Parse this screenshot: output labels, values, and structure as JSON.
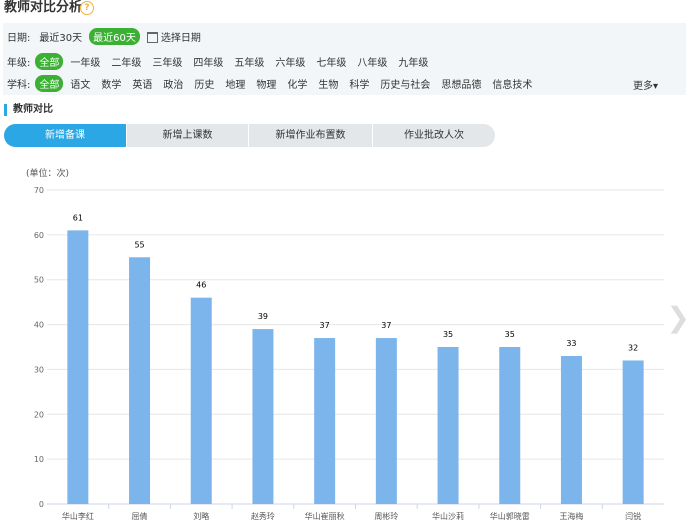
{
  "page": {
    "title": "教师对比分析",
    "help_icon": "question-circle-icon"
  },
  "filters": {
    "date": {
      "label": "日期:",
      "options": [
        "最近30天",
        "最近60天"
      ],
      "active_index": 1,
      "picker_label": "选择日期",
      "picker_icon": "calendar-icon"
    },
    "grade": {
      "label": "年级:",
      "options": [
        "全部",
        "一年级",
        "二年级",
        "三年级",
        "四年级",
        "五年级",
        "六年级",
        "七年级",
        "八年级",
        "九年级"
      ],
      "active_index": 0
    },
    "subject": {
      "label": "学科:",
      "options": [
        "全部",
        "语文",
        "数学",
        "英语",
        "政治",
        "历史",
        "地理",
        "物理",
        "化学",
        "生物",
        "科学",
        "历史与社会",
        "思想品德",
        "信息技术"
      ],
      "active_index": 0,
      "more_label": "更多"
    }
  },
  "section": {
    "title": "教师对比"
  },
  "tabs": [
    {
      "label": "新增备课",
      "active": true
    },
    {
      "label": "新增上课数",
      "active": false
    },
    {
      "label": "新增作业布置数",
      "active": false
    },
    {
      "label": "作业批改人次",
      "active": false
    }
  ],
  "chart_data": {
    "type": "bar",
    "unit_label": "(单位：次)",
    "categories": [
      "华山李红",
      "屈倩",
      "刘略",
      "赵秀玲",
      "华山崔丽秋",
      "周彬玲",
      "华山沙莉",
      "华山郭晓雷",
      "王海梅",
      "闫锐"
    ],
    "values": [
      61,
      55,
      46,
      39,
      37,
      37,
      35,
      35,
      33,
      32
    ],
    "ylim": [
      0,
      70
    ],
    "yticks": [
      0,
      10,
      20,
      30,
      40,
      50,
      60,
      70
    ],
    "grid": true,
    "bar_color": "#7cb5ec"
  },
  "nav": {
    "next_icon": "chevron-right-icon"
  }
}
